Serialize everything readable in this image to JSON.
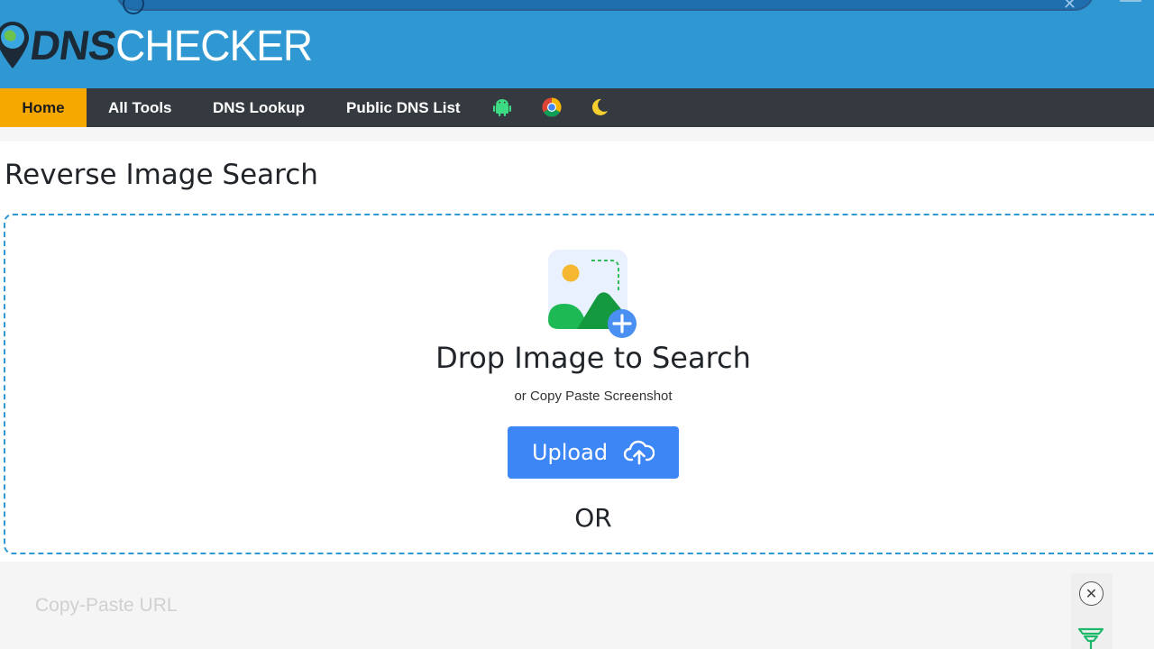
{
  "header": {
    "logo_dns": "DNS",
    "logo_checker": "CHECKER"
  },
  "nav": {
    "items": [
      {
        "label": "Home",
        "active": true
      },
      {
        "label": "All Tools"
      },
      {
        "label": "DNS Lookup"
      },
      {
        "label": "Public DNS List"
      }
    ],
    "icons": [
      "android-icon",
      "chrome-icon",
      "moon-icon"
    ]
  },
  "page": {
    "title": "Reverse Image Search"
  },
  "dropzone": {
    "icon": "image-add-icon",
    "title": "Drop Image to Search",
    "subtitle": "or Copy Paste Screenshot",
    "upload_label": "Upload",
    "upload_icon": "cloud-upload-icon",
    "or_label": "OR"
  },
  "lower": {
    "label": "Copy-Paste URL"
  },
  "colors": {
    "header_blue": "#2f98d2",
    "nav_dark": "#343a40",
    "nav_active": "#f5a900",
    "upload_blue": "#3d86f5",
    "dash_border": "#2f98d2"
  }
}
